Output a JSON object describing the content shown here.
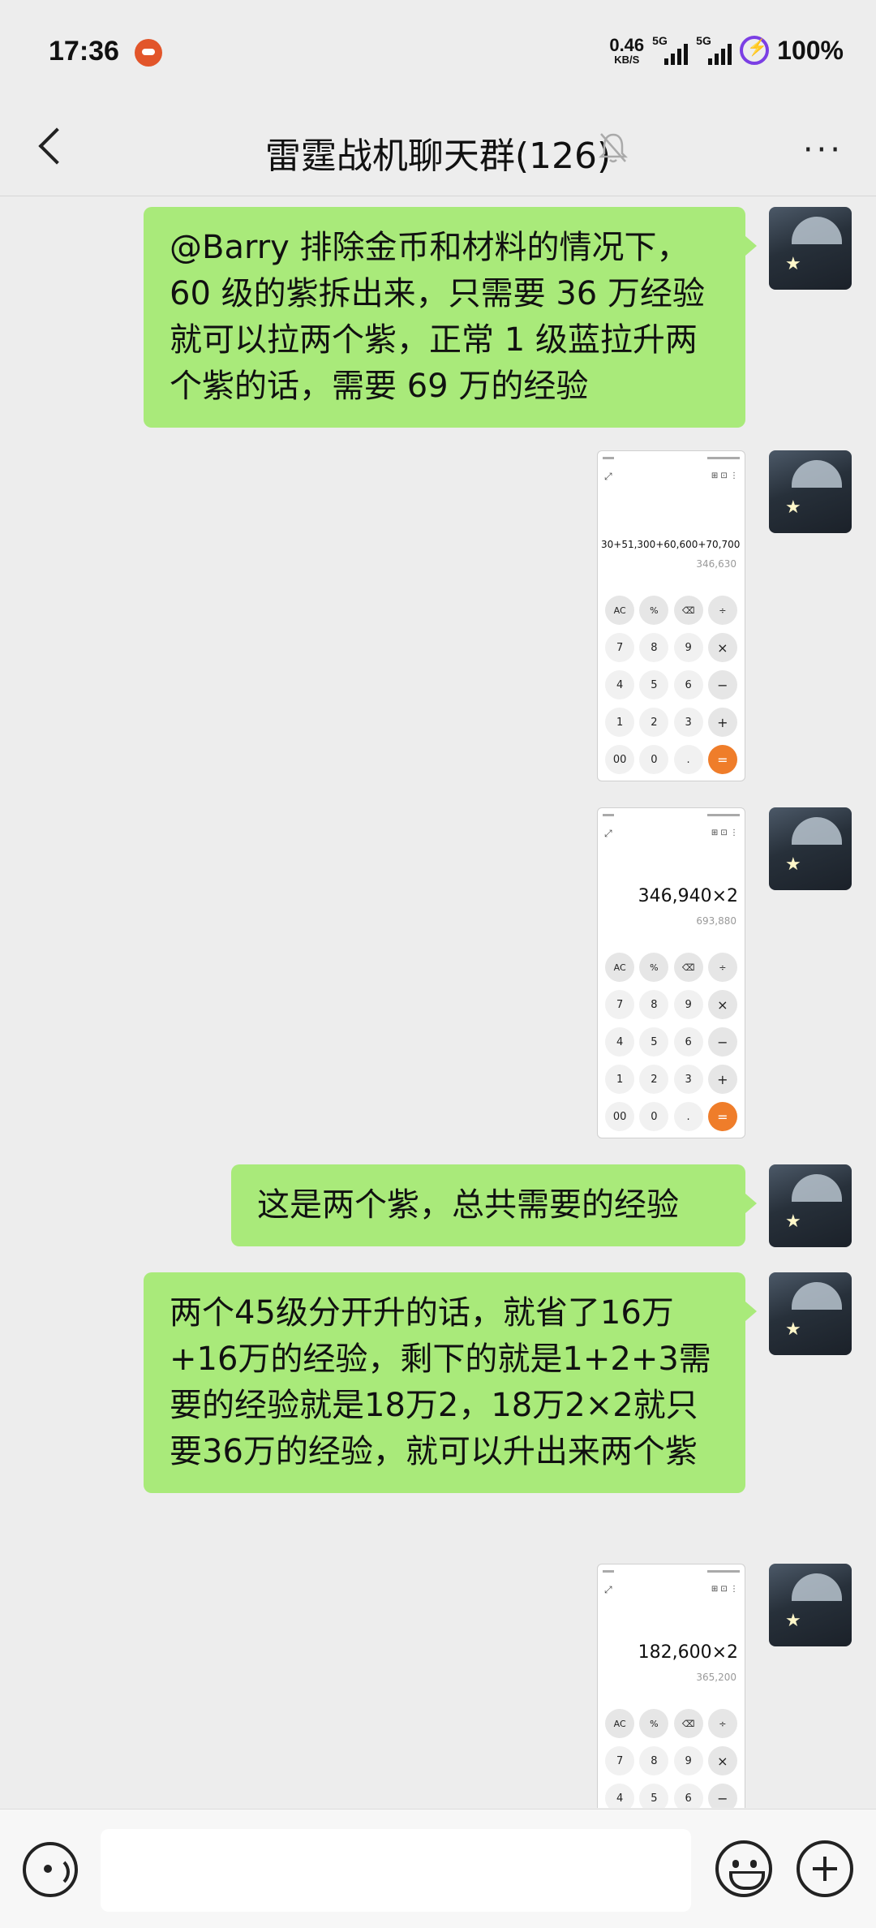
{
  "status_bar": {
    "time": "17:36",
    "net_speed_value": "0.46",
    "net_speed_unit": "KB/S",
    "sim1": "5G",
    "sim2": "5G",
    "battery": "100%"
  },
  "header": {
    "title": "雷霆战机聊天群(126)",
    "more_label": "···"
  },
  "messages": [
    {
      "type": "text",
      "text": "@Barry 排除金币和材料的情况下，60 级的紫拆出来，只需要 36 万经验就可以拉两个紫，正常 1 级蓝拉升两个紫的话，需要 69 万的经验"
    },
    {
      "type": "image",
      "expression": "30+51,300+60,600+70,700",
      "result": "346,630"
    },
    {
      "type": "image",
      "expression": "346,940×2",
      "result": "693,880"
    },
    {
      "type": "text",
      "text": "这是两个紫，总共需要的经验"
    },
    {
      "type": "text",
      "text": "两个45级分开升的话，就省了16万+16万的经验，剩下的就是1+2+3需要的经验就是18万2，18万2×2就只要36万的经验，就可以升出来两个紫"
    },
    {
      "type": "image",
      "expression": "182,600×2",
      "result": "365,200"
    }
  ],
  "calculator_keys": [
    "AC",
    "%",
    "⌫",
    "÷",
    "7",
    "8",
    "9",
    "×",
    "4",
    "5",
    "6",
    "−",
    "1",
    "2",
    "3",
    "+",
    "00",
    "0",
    ".",
    "="
  ],
  "input": {
    "placeholder": ""
  },
  "colors": {
    "bubble": "#a9ea7a",
    "background": "#ededed",
    "equals_key": "#ef7d2a"
  }
}
